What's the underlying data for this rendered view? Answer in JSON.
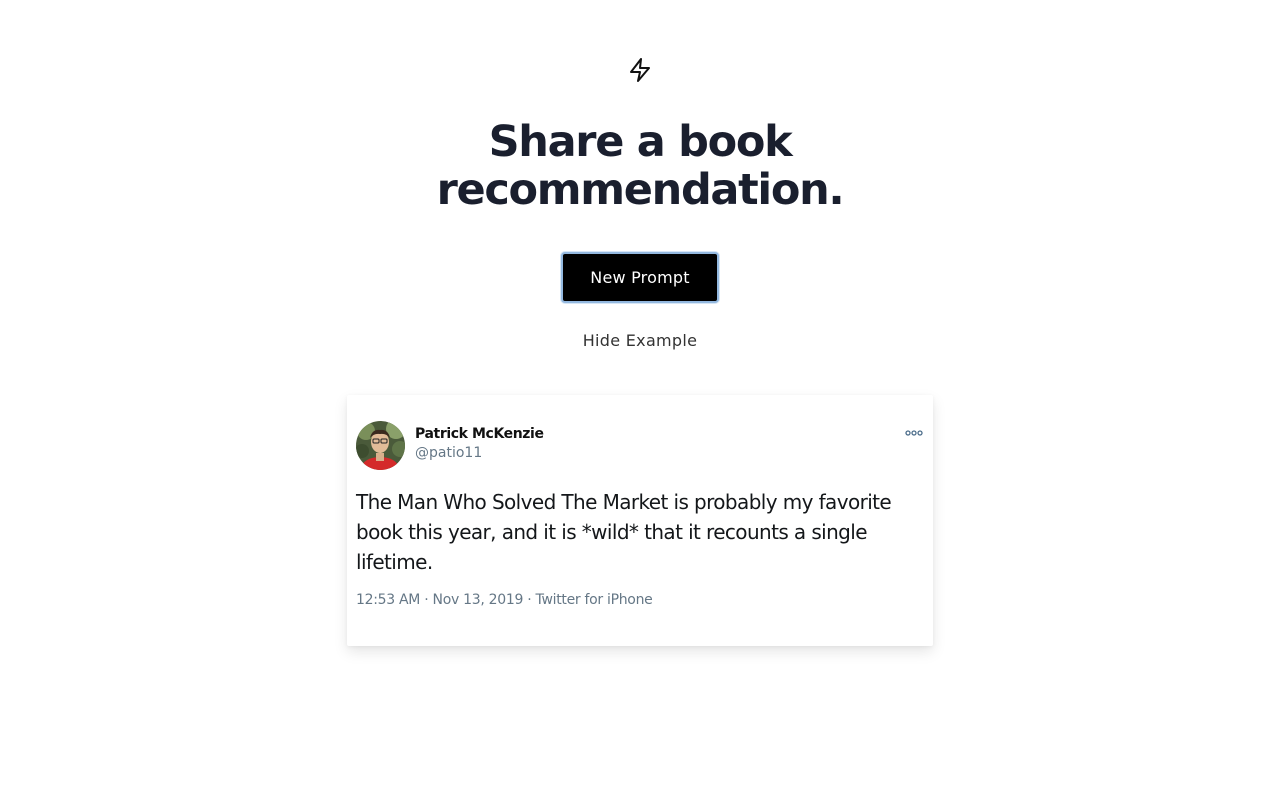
{
  "logo": {
    "icon": "lightning-bolt-icon"
  },
  "headline": {
    "line1": "Share a book",
    "line2": "recommendation."
  },
  "actions": {
    "new_prompt_label": "New Prompt",
    "hide_example_label": "Hide Example"
  },
  "tweet": {
    "author_name": "Patrick McKenzie",
    "author_handle": "@patio11",
    "avatar_icon": "avatar-photo",
    "more_icon": "more-options-icon",
    "text": "The Man Who Solved The Market is probably my favorite book this year, and it is *wild* that it recounts a single lifetime.",
    "time": "12:53 AM",
    "date": "Nov 13, 2019",
    "source": "Twitter for iPhone"
  },
  "colors": {
    "headline": "#1a1f2e",
    "button_bg": "#000000",
    "button_border": "#93b8df",
    "meta_text": "#657786"
  }
}
